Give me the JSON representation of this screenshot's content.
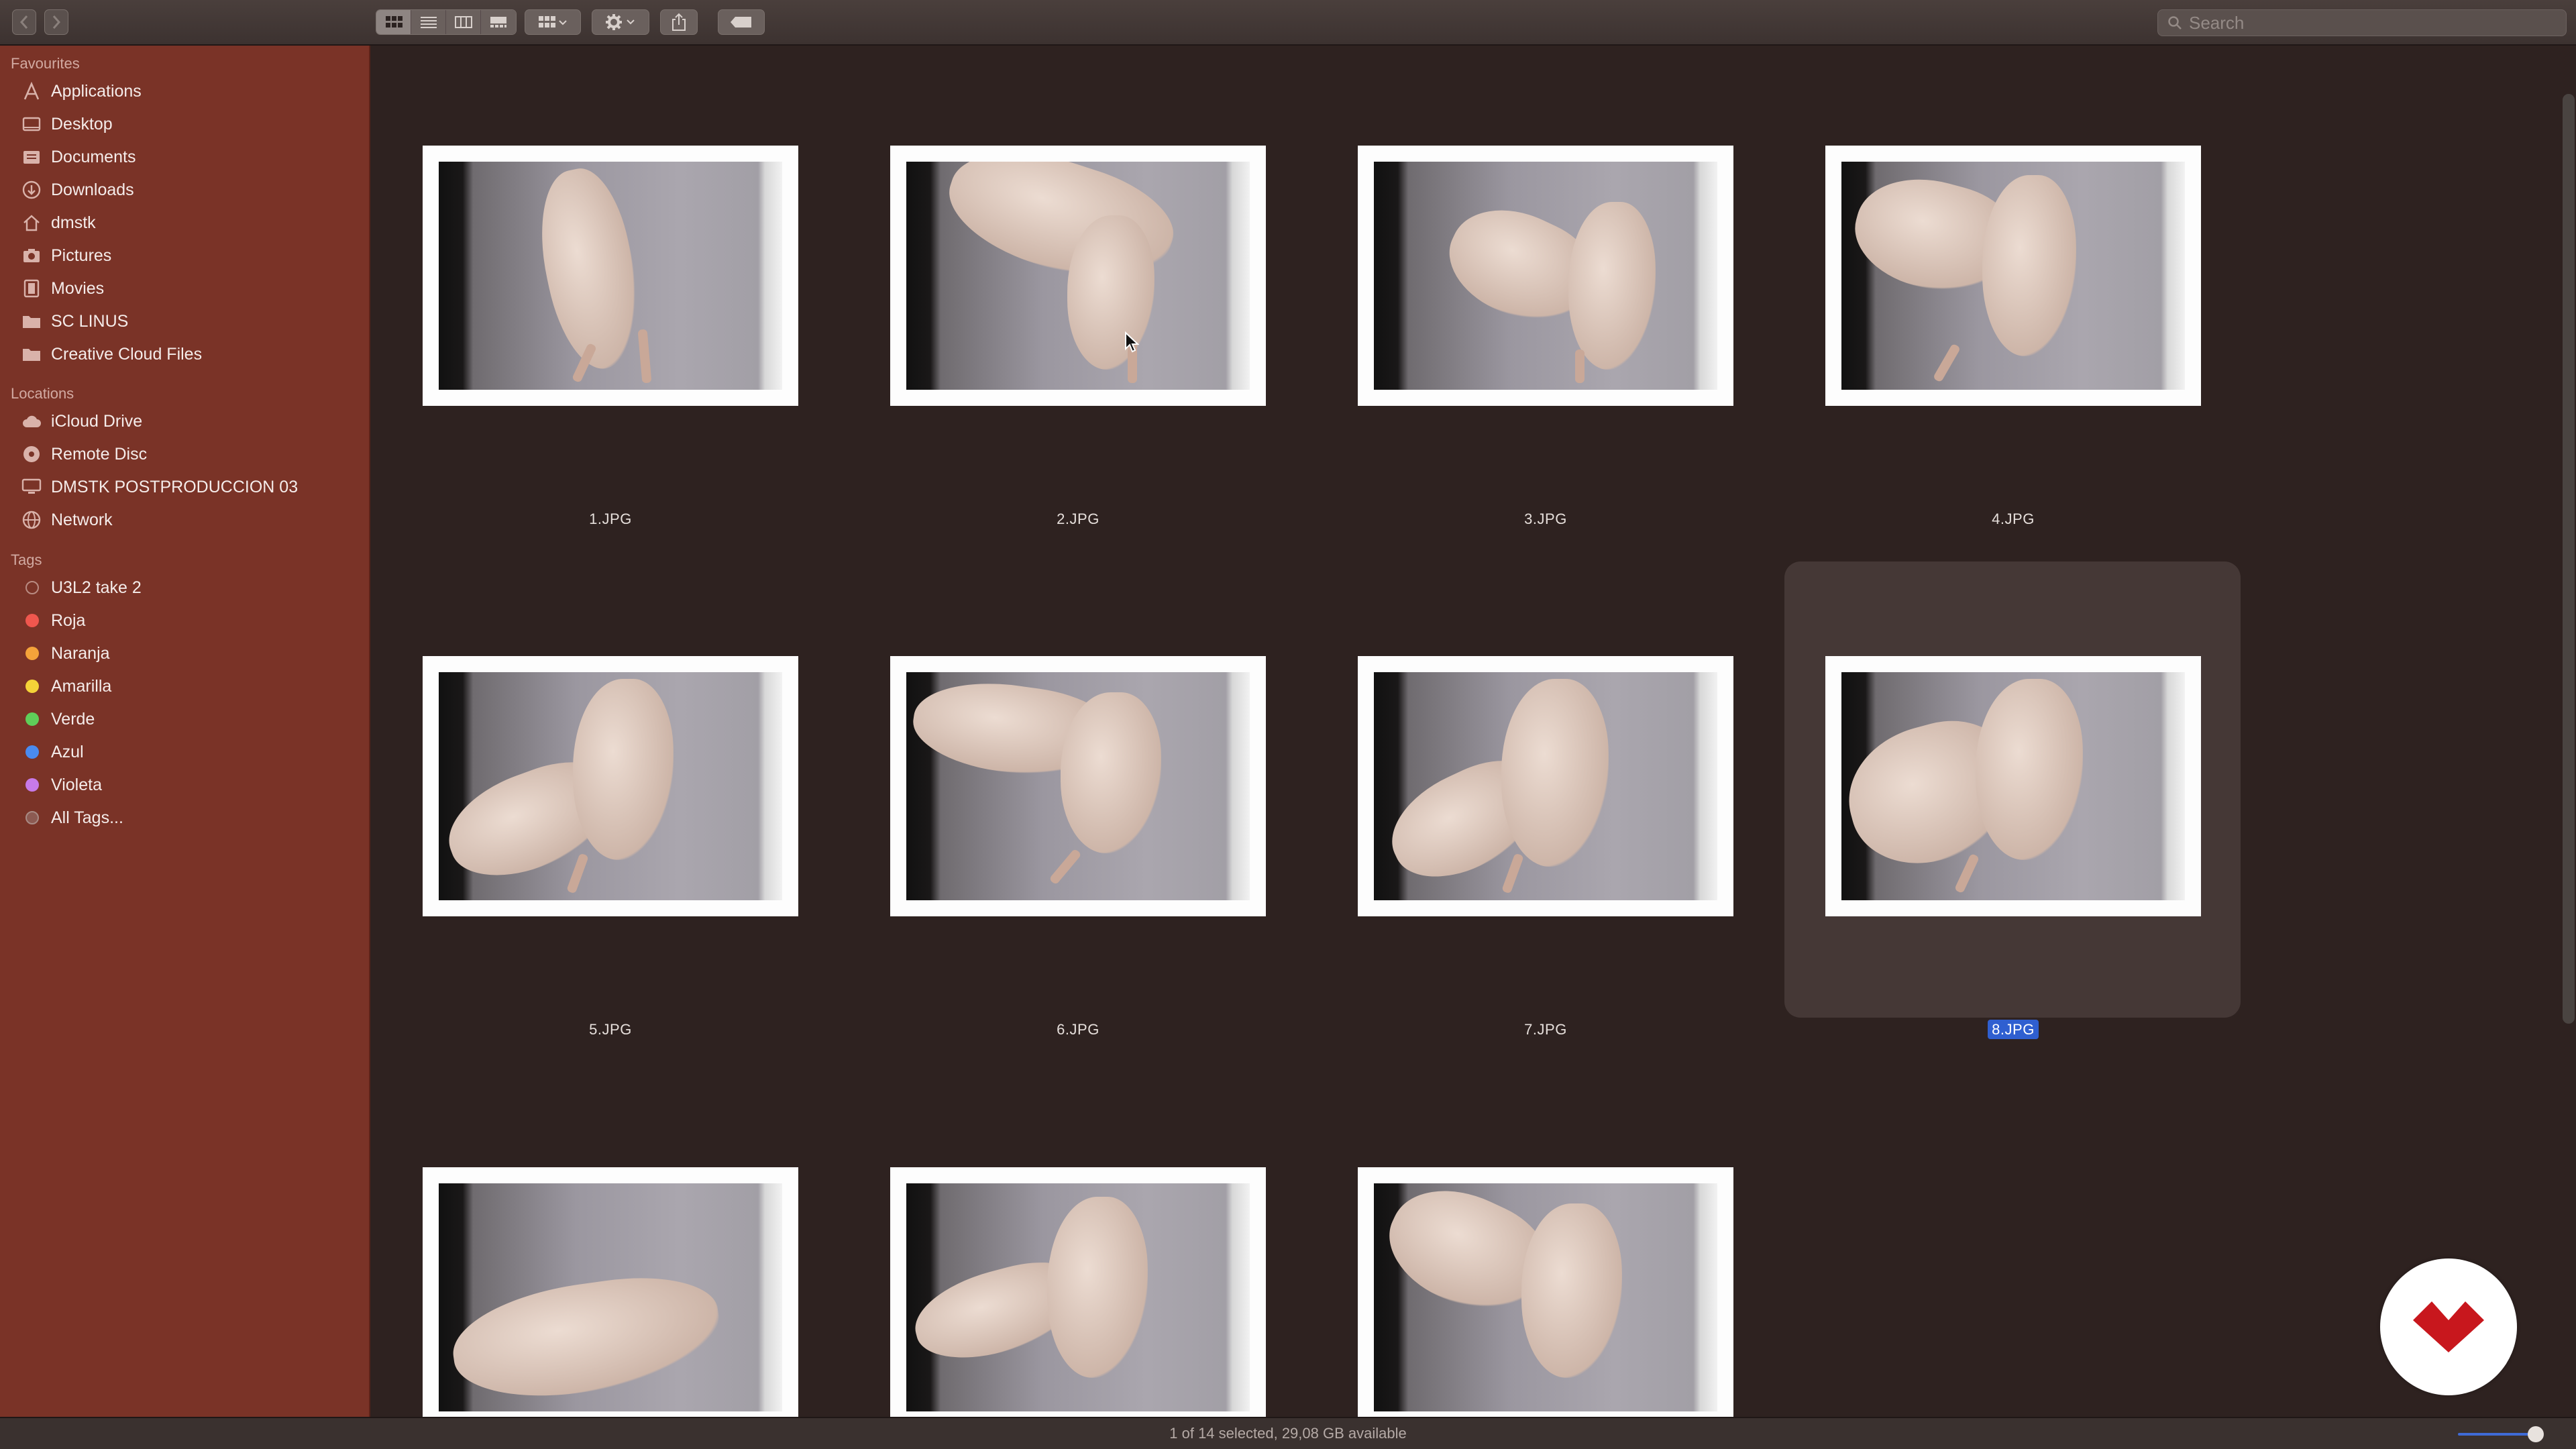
{
  "toolbar": {
    "search_placeholder": "Search",
    "icons": [
      "back-arrow-icon",
      "forward-arrow-icon",
      "icon-view-icon",
      "list-view-icon",
      "column-view-icon",
      "gallery-view-icon",
      "group-icon",
      "gear-icon",
      "share-icon",
      "tag-icon",
      "search-icon"
    ]
  },
  "sidebar": {
    "favourites_title": "Favourites",
    "favourites": [
      {
        "label": "Applications",
        "icon": "applications-icon"
      },
      {
        "label": "Desktop",
        "icon": "desktop-icon"
      },
      {
        "label": "Documents",
        "icon": "documents-icon"
      },
      {
        "label": "Downloads",
        "icon": "downloads-icon"
      },
      {
        "label": "dmstk",
        "icon": "home-icon"
      },
      {
        "label": "Pictures",
        "icon": "pictures-icon"
      },
      {
        "label": "Movies",
        "icon": "movies-icon"
      },
      {
        "label": "SC LINUS",
        "icon": "folder-icon"
      },
      {
        "label": "Creative Cloud Files",
        "icon": "folder-icon"
      }
    ],
    "locations_title": "Locations",
    "locations": [
      {
        "label": "iCloud Drive",
        "icon": "cloud-icon"
      },
      {
        "label": "Remote Disc",
        "icon": "disc-icon"
      },
      {
        "label": "DMSTK POSTPRODUCCION 03",
        "icon": "computer-icon"
      },
      {
        "label": "Network",
        "icon": "network-icon"
      }
    ],
    "tags_title": "Tags",
    "tags": [
      {
        "label": "U3L2 take 2",
        "color": "hollow"
      },
      {
        "label": "Roja",
        "color": "#f0574e"
      },
      {
        "label": "Naranja",
        "color": "#f5a33a"
      },
      {
        "label": "Amarilla",
        "color": "#f4d338"
      },
      {
        "label": "Verde",
        "color": "#5fce59"
      },
      {
        "label": "Azul",
        "color": "#4a8bf0"
      },
      {
        "label": "Violeta",
        "color": "#c77ae8"
      },
      {
        "label": "All Tags...",
        "color": "hollow-gray"
      }
    ]
  },
  "files": [
    {
      "name": "1.JPG",
      "selected": false
    },
    {
      "name": "2.JPG",
      "selected": false
    },
    {
      "name": "3.JPG",
      "selected": false
    },
    {
      "name": "4.JPG",
      "selected": false
    },
    {
      "name": "5.JPG",
      "selected": false
    },
    {
      "name": "6.JPG",
      "selected": false
    },
    {
      "name": "7.JPG",
      "selected": false
    },
    {
      "name": "8.JPG",
      "selected": true
    },
    {
      "name": "",
      "selected": false
    },
    {
      "name": "",
      "selected": false
    },
    {
      "name": "",
      "selected": false
    }
  ],
  "status": {
    "text": "1 of 14 selected, 29,08 GB available"
  },
  "colors": {
    "sidebar": "#7a3327",
    "main_bg": "#2e2220",
    "selection": "#2f5fd0"
  }
}
